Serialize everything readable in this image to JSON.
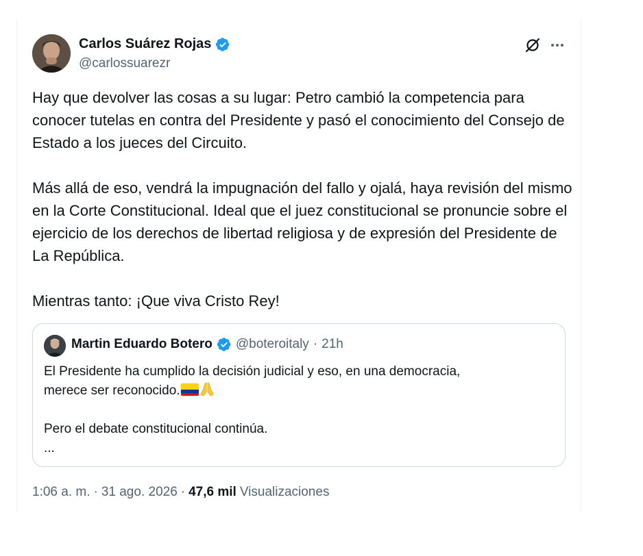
{
  "author": {
    "display_name": "Carlos Suárez Rojas",
    "handle": "@carlossuarezr",
    "verified": true
  },
  "tweet": {
    "paragraphs": [
      "Hay que devolver las cosas a su lugar: Petro cambió la competencia para conocer tutelas en contra del Presidente y pasó el conocimiento del Consejo de Estado a los jueces del Circuito.",
      "Más allá de eso, vendrá la impugnación del fallo y ojalá, haya revisión del mismo en la Corte Constitucional. Ideal que el juez constitucional se pronuncie sobre el ejercicio de los derechos de libertad religiosa y de expresión del Presidente de La República.",
      "Mientras tanto: ¡Que viva Cristo Rey!"
    ]
  },
  "quoted_tweet": {
    "display_name": "Martin Eduardo Botero",
    "handle": "@boteroitaly",
    "separator": "·",
    "time": "21h",
    "line1": "El Presidente ha cumplido la decisión judicial y eso, en una democracia,",
    "line2": "merece ser reconocido.",
    "line3": "Pero el debate constitucional continúa.",
    "line4": "..."
  },
  "meta": {
    "time": "1:06 a. m.",
    "sep1": "·",
    "date": "31 ago. 2026",
    "sep2": "·",
    "views_count": "47,6 mil",
    "views_label": "Visualizaciones"
  },
  "icons": {
    "verified": "verified-badge-icon",
    "grok": "grok-icon",
    "more": "more-options-icon",
    "flag": "colombia-flag-emoji",
    "pray": "folded-hands-emoji"
  },
  "colors": {
    "verified": "#1d9bf0",
    "secondary_text": "#536471",
    "primary_text": "#0f1419",
    "border": "#cfd9de"
  }
}
